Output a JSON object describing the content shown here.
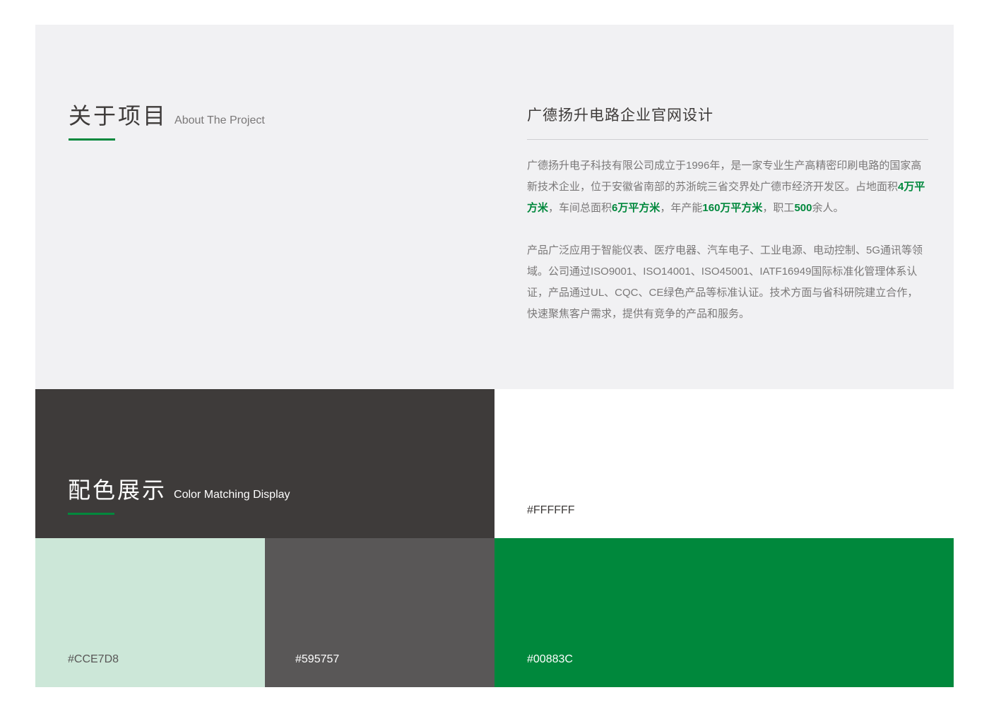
{
  "about": {
    "title_cn": "关于项目",
    "title_en": "About The Project",
    "project_title": "广德扬升电路企业官网设计",
    "paragraph1": {
      "part1": "广德扬升电子科技有限公司成立于1996年，是一家专业生产高精密印刷电路的国家高新技术企业，位于安徽省南部的苏浙皖三省交界处广德市经济开发区。占地面积",
      "area": "4万平方米",
      "part2": "，车间总面积",
      "workshop_area": "6万平方米",
      "part3": "，年产能",
      "capacity": "160万平方米",
      "part4": "，职工",
      "staff": "500",
      "part5": "余人。"
    },
    "paragraph2": "产品广泛应用于智能仪表、医疗电器、汽车电子、工业电源、电动控制、5G通讯等领域。公司通过ISO9001、ISO14001、ISO45001、IATF16949国际标准化管理体系认证，产品通过UL、CQC、CE绿色产品等标准认证。技术方面与省科研院建立合作，快速聚焦客户需求，提供有竞争的产品和服务。"
  },
  "colors": {
    "title_cn": "配色展示",
    "title_en": "Color Matching Display",
    "swatches": [
      {
        "hex": "#FFFFFF",
        "label": "#FFFFFF"
      },
      {
        "hex": "#CCE7D8",
        "label": "#CCE7D8"
      },
      {
        "hex": "#595757",
        "label": "#595757"
      },
      {
        "hex": "#00883C",
        "label": "#00883C"
      }
    ],
    "dark_panel": "#3E3B3A",
    "accent": "#00883C"
  }
}
